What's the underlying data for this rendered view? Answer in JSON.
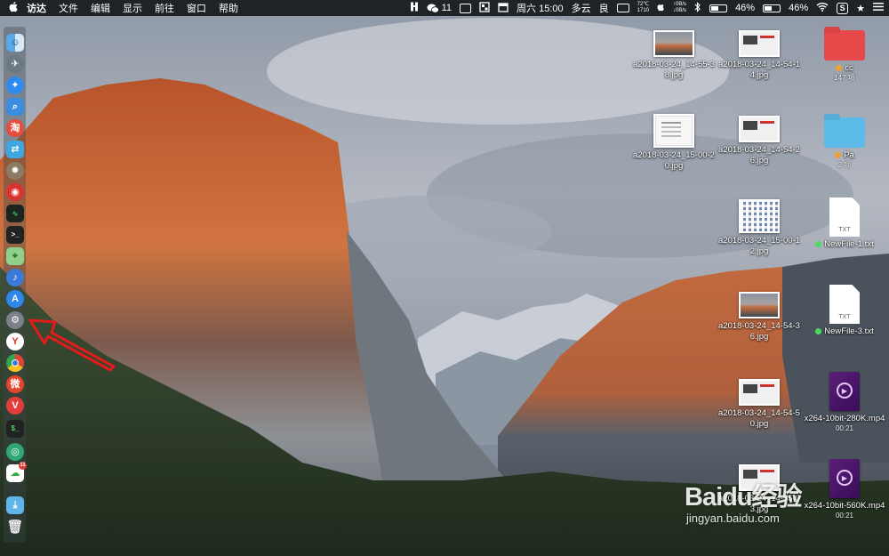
{
  "menubar": {
    "apple": "",
    "items": [
      "访达",
      "文件",
      "编辑",
      "显示",
      "前往",
      "窗口",
      "帮助"
    ],
    "wechat_count": "11",
    "temp": "72℃",
    "fan": "1710",
    "net_up": "0B/s",
    "net_down": "0B/s",
    "datetime": "周六 15:00",
    "weather": "多云",
    "air": "良",
    "cpu": "46%",
    "battery": "46%",
    "s_logo": "S",
    "star": "★"
  },
  "dock": {
    "icons": [
      "finder-icon",
      "launchpad-icon",
      "safari-icon",
      "preview-icon",
      "taobao-icon",
      "migration-icon",
      "rocket-icon",
      "netease-music-icon",
      "activity-monitor-icon",
      "terminal-icon",
      "maps-icon",
      "voice-input-icon",
      "app-store-icon",
      "system-preferences-icon",
      "yandex-browser-icon",
      "chrome-icon",
      "weibo-icon",
      "vivaldi-icon",
      "console-icon",
      "camtasia-icon",
      "wechat-icon",
      "downloads-icon",
      "trash-icon"
    ],
    "wechat_badge": "11"
  },
  "desktop": {
    "files": [
      {
        "name": "a2018-03-24_14-55-38.jpg",
        "kind": "landscape"
      },
      {
        "name": "a2018-03-24_14-54-14.jpg",
        "kind": "screen"
      },
      {
        "name": "cc",
        "sub": "147 项",
        "kind": "folder-red",
        "tag": "#f0a030"
      },
      {
        "name": "a2018-03-24_15-00-20.jpg",
        "kind": "note"
      },
      {
        "name": "a2018-03-24_14-54-26.jpg",
        "kind": "screen"
      },
      {
        "name": "Pa",
        "sub": "2 项",
        "kind": "folder-blue",
        "tag": "#f0a030"
      },
      {
        "name": "a2018-03-24_15-00-12.jpg",
        "kind": "grid"
      },
      {
        "name": "NewFile-1.txt",
        "kind": "txt",
        "tag": "#4cd964"
      },
      {
        "name": "a2018-03-24_14-54-36.jpg",
        "kind": "landscape"
      },
      {
        "name": "NewFile-3.txt",
        "kind": "txt",
        "tag": "#4cd964"
      },
      {
        "name": "a2018-03-24_14-54-50.jpg",
        "kind": "screen"
      },
      {
        "name": "x264-10bit-280K.mp4",
        "sub": "00:21",
        "kind": "mp4"
      },
      {
        "name": "a2018-03-24_14-55-03.jpg",
        "kind": "screen"
      },
      {
        "name": "x264-10bit-560K.mp4",
        "sub": "00:21",
        "kind": "mp4"
      }
    ],
    "txt_badge": "TXT"
  },
  "watermark": {
    "brand": "Baidu经验",
    "url": "jingyan.baidu.com"
  },
  "colors": {
    "menubar_bg": "#16181c",
    "annotation": "#e21b1b"
  }
}
